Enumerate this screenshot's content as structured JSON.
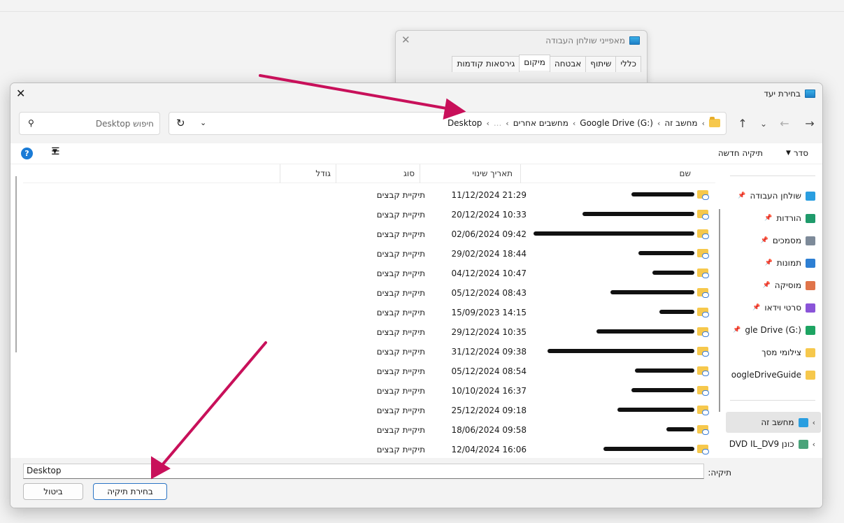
{
  "props_window": {
    "title": "מאפייני שולחן העבודה",
    "tabs": [
      "כללי",
      "שיתוף",
      "אבטחה",
      "מיקום",
      "גירסאות קודמות"
    ],
    "selected_tab": "מיקום"
  },
  "dialog": {
    "title": "בחירת יעד",
    "breadcrumbs": [
      "מחשב זה",
      "Google Drive (G:)",
      "מחשבים אחרים",
      "...",
      "Desktop"
    ],
    "search_placeholder": "חיפוש Desktop",
    "toolbar": {
      "sort": "סדר",
      "new_folder": "תיקיה חדשה"
    },
    "columns": {
      "name": "שם",
      "modified": "תאריך שינוי",
      "type": "סוג",
      "size": "גודל"
    },
    "files": [
      {
        "modified": "11/12/2024 21:29",
        "type": "תיקיית קבצים"
      },
      {
        "modified": "20/12/2024 10:33",
        "type": "תיקיית קבצים"
      },
      {
        "modified": "02/06/2024 09:42",
        "type": "תיקיית קבצים"
      },
      {
        "modified": "29/02/2024 18:44",
        "type": "תיקיית קבצים"
      },
      {
        "modified": "04/12/2024 10:47",
        "type": "תיקיית קבצים"
      },
      {
        "modified": "05/12/2024 08:43",
        "type": "תיקיית קבצים"
      },
      {
        "modified": "15/09/2023 14:15",
        "type": "תיקיית קבצים"
      },
      {
        "modified": "29/12/2024 10:35",
        "type": "תיקיית קבצים"
      },
      {
        "modified": "31/12/2024 09:38",
        "type": "תיקיית קבצים"
      },
      {
        "modified": "05/12/2024 08:54",
        "type": "תיקיית קבצים"
      },
      {
        "modified": "10/10/2024 16:37",
        "type": "תיקיית קבצים"
      },
      {
        "modified": "25/12/2024 09:18",
        "type": "תיקיית קבצים"
      },
      {
        "modified": "18/06/2024 09:58",
        "type": "תיקיית קבצים"
      },
      {
        "modified": "12/04/2024 16:06",
        "type": "תיקיית קבצים"
      }
    ],
    "nav": [
      {
        "label": "שולחן העבודה",
        "icon": "desktop-icon",
        "color": "#2a9ee0"
      },
      {
        "label": "הורדות",
        "icon": "download-icon",
        "color": "#1f9a6b"
      },
      {
        "label": "מסמכים",
        "icon": "documents-icon",
        "color": "#7d8a99"
      },
      {
        "label": "תמונות",
        "icon": "pictures-icon",
        "color": "#2d7fd3"
      },
      {
        "label": "מוסיקה",
        "icon": "music-icon",
        "color": "#e0744a"
      },
      {
        "label": "סרטי וידאו",
        "icon": "video-icon",
        "color": "#8a54d8"
      },
      {
        "label": "gle Drive (G:)",
        "icon": "google-drive-icon",
        "color": "#1da462"
      },
      {
        "label": "צילומי מסך",
        "icon": "folder-icon",
        "color": "#f6c84c"
      },
      {
        "label": "oogleDriveGuide",
        "icon": "folder-icon",
        "color": "#f6c84c"
      }
    ],
    "nav_this_pc": "מחשב זה",
    "nav_dvd": "כונן DVD IL_DV9",
    "folder_label": "תיקיה:",
    "folder_value": "Desktop",
    "select_button": "בחירת תיקיה",
    "cancel_button": "ביטול"
  }
}
